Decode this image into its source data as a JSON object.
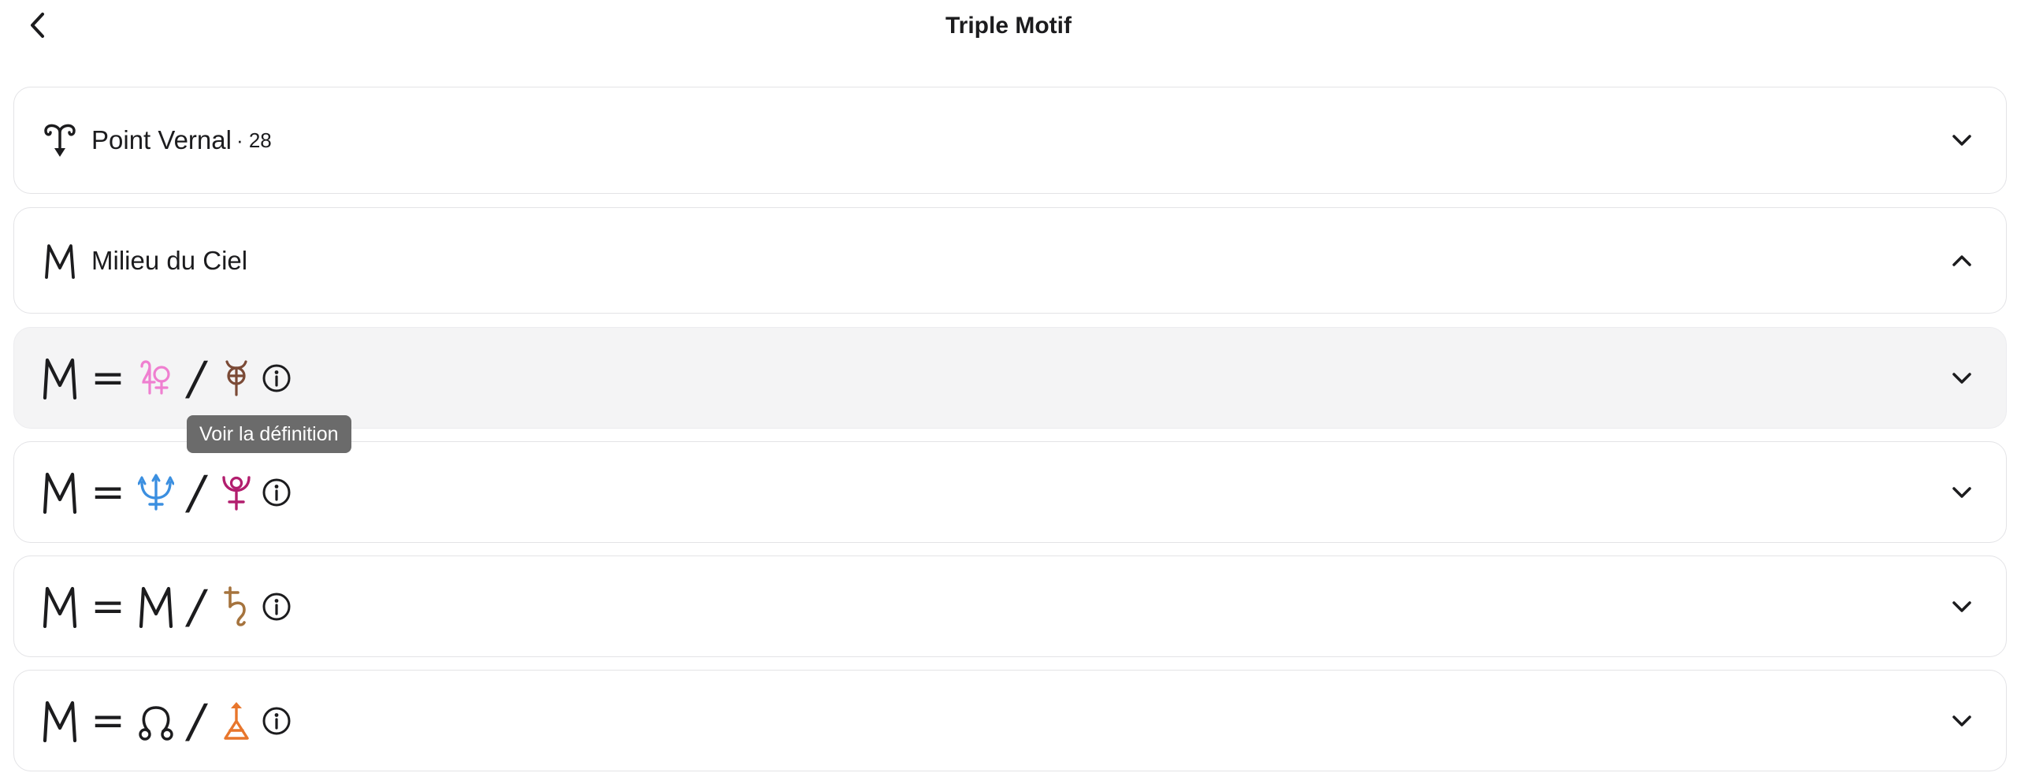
{
  "header": {
    "title": "Triple Motif",
    "back_icon": "chevron-left-icon"
  },
  "sections": [
    {
      "icon": "aries-point-icon",
      "label": "Point Vernal",
      "count": "· 28",
      "state": "collapsed"
    },
    {
      "icon": "midheaven-icon",
      "label": "Milieu du Ciel",
      "state": "expanded"
    }
  ],
  "formulas": [
    {
      "left": "midheaven-icon",
      "operator": "=",
      "a": {
        "icon": "venus-jupiter-icon",
        "color": "#ef7fd0"
      },
      "separator": "/",
      "b": {
        "icon": "vulcan-icon",
        "color": "#7b4a36"
      },
      "highlighted": true
    },
    {
      "left": "midheaven-icon",
      "operator": "=",
      "a": {
        "icon": "neptune-icon",
        "color": "#3b8fe0"
      },
      "separator": "/",
      "b": {
        "icon": "pluto-icon",
        "color": "#b21e6e"
      },
      "highlighted": false
    },
    {
      "left": "midheaven-icon",
      "operator": "=",
      "a": {
        "icon": "midheaven-icon",
        "color": "#000000"
      },
      "separator": "/",
      "b": {
        "icon": "saturn-icon",
        "color": "#a5733d"
      },
      "highlighted": false
    },
    {
      "left": "midheaven-icon",
      "operator": "=",
      "a": {
        "icon": "north-node-icon",
        "color": "#000000"
      },
      "separator": "/",
      "b": {
        "icon": "vertex-arrow-icon",
        "color": "#e8762c"
      },
      "highlighted": false
    }
  ],
  "tooltip": {
    "text": "Voir la définition"
  },
  "colors": {
    "card_border": "#e3e3e6",
    "card_highlight": "#f4f4f5",
    "tooltip_bg": "#6b6b6b"
  }
}
